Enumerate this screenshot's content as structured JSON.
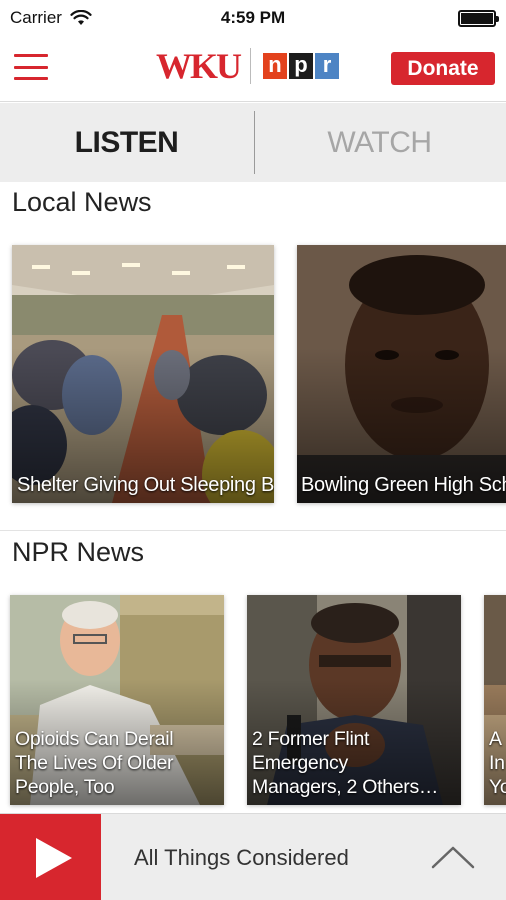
{
  "status_bar": {
    "carrier": "Carrier",
    "time": "4:59 PM",
    "wifi_icon": "wifi-icon",
    "battery_icon": "battery-icon"
  },
  "header": {
    "logo_text": "WKU",
    "npr_letters": [
      "n",
      "p",
      "r"
    ],
    "donate_label": "Donate",
    "brand_color": "#d7262e"
  },
  "tabs": [
    {
      "label": "LISTEN",
      "active": true
    },
    {
      "label": "WATCH",
      "active": false
    }
  ],
  "local_news": {
    "title": "Local News",
    "cards": [
      {
        "caption": "Shelter Giving Out\nSleeping Bag Jackets as\nCold Moves Across Region"
      },
      {
        "caption": "Bowling Green High School\nEmployee Facing Sex\nAbuse Charges"
      }
    ]
  },
  "npr_news": {
    "title": "NPR News",
    "cards": [
      {
        "caption": "Opioids Can Derail\nThe Lives Of Older\nPeople, Too"
      },
      {
        "caption": "2 Former Flint\nEmergency\nManagers, 2 Others…"
      },
      {
        "caption": "A\nIn\nYo"
      }
    ]
  },
  "player": {
    "program_title": "All Things Considered",
    "play_icon": "play-icon",
    "expand_icon": "chevron-up-icon"
  }
}
